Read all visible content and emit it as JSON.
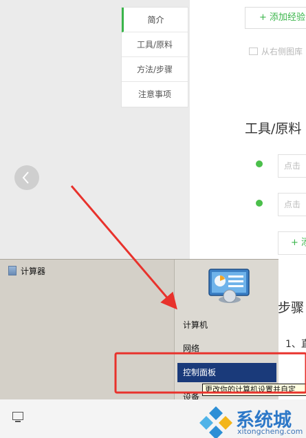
{
  "side_nav": [
    {
      "label": "简介"
    },
    {
      "label": "工具/原料"
    },
    {
      "label": "方法/步骤"
    },
    {
      "label": "注意事项"
    }
  ],
  "content": {
    "add_experience": "+ 添加经验",
    "image_hint": "从右侧图库",
    "tools_title": "工具/原料",
    "tool_placeholder_1": "点击",
    "tool_placeholder_2": "点击",
    "add_small": "+ 添",
    "steps_title": "步骤",
    "step_1": "1、直"
  },
  "start_menu": {
    "calculator": "计算器",
    "computer": "计算机",
    "network": "网络",
    "control_panel": "控制面板",
    "devices": "设备",
    "tooltip": "更改你的计算机设置并自定"
  },
  "watermark": {
    "brand": "系统城",
    "url": "xitongcheng.com"
  },
  "colors": {
    "accent_green": "#3ab54a",
    "highlight": "#1a3a7a",
    "annotation_red": "#e8322c",
    "watermark_blue": "#2d78c8"
  }
}
